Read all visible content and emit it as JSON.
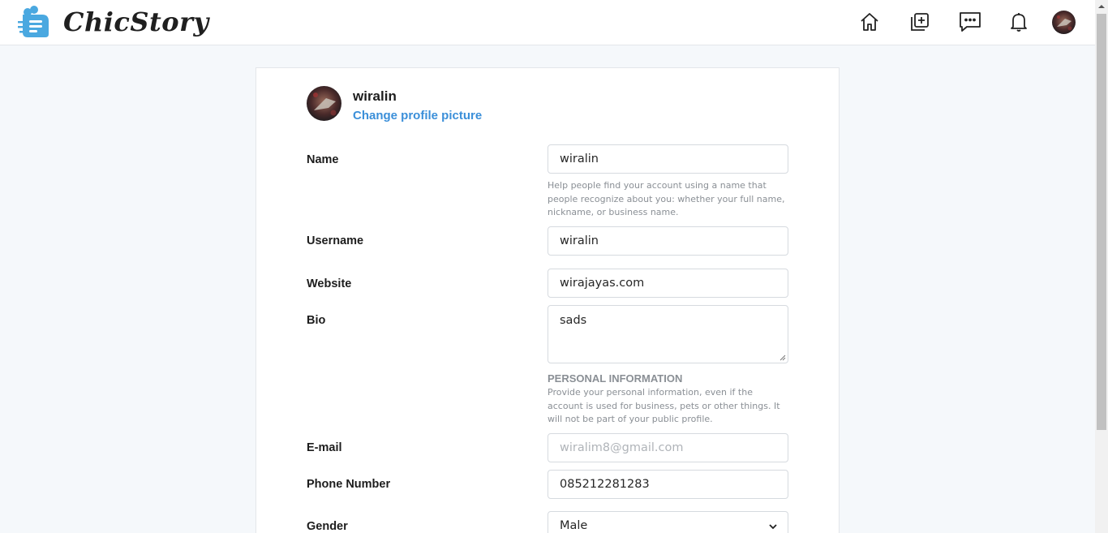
{
  "app": {
    "name": "ChicStory"
  },
  "nav": {
    "icons": [
      "home-icon",
      "add-post-icon",
      "messages-icon",
      "notifications-icon"
    ]
  },
  "profile": {
    "username": "wiralin",
    "change_picture": "Change profile picture"
  },
  "form": {
    "name": {
      "label": "Name",
      "value": "wiralin",
      "help": "Help people find your account using a name that people recognize about you: whether your full name, nickname, or business name."
    },
    "username": {
      "label": "Username",
      "value": "wiralin"
    },
    "website": {
      "label": "Website",
      "value": "wirajayas.com"
    },
    "bio": {
      "label": "Bio",
      "value": "sads"
    },
    "personal_info": {
      "title": "PERSONAL INFORMATION",
      "help": "Provide your personal information, even if the account is used for business, pets or other things. It will not be part of your public profile."
    },
    "email": {
      "label": "E-mail",
      "value": "wiralim8@gmail.com"
    },
    "phone": {
      "label": "Phone Number",
      "value": "085212281283"
    },
    "gender": {
      "label": "Gender",
      "value": "Male"
    }
  },
  "colors": {
    "accent": "#3b8fd9",
    "logo": "#4aa8e0"
  }
}
